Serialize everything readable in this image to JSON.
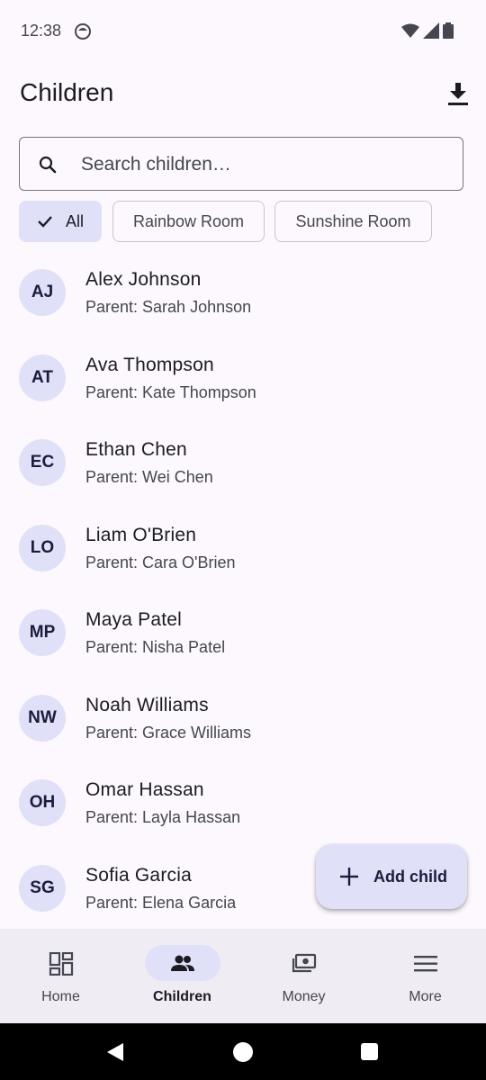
{
  "status_bar": {
    "time": "12:38"
  },
  "header": {
    "title": "Children"
  },
  "search": {
    "placeholder": "Search children…"
  },
  "filters": [
    {
      "label": "All",
      "selected": true
    },
    {
      "label": "Rainbow Room",
      "selected": false
    },
    {
      "label": "Sunshine Room",
      "selected": false
    }
  ],
  "children": [
    {
      "initials": "AJ",
      "name": "Alex Johnson",
      "parent": "Parent: Sarah Johnson"
    },
    {
      "initials": "AT",
      "name": "Ava Thompson",
      "parent": "Parent: Kate Thompson"
    },
    {
      "initials": "EC",
      "name": "Ethan Chen",
      "parent": "Parent: Wei Chen"
    },
    {
      "initials": "LO",
      "name": "Liam O'Brien",
      "parent": "Parent: Cara O'Brien"
    },
    {
      "initials": "MP",
      "name": "Maya Patel",
      "parent": "Parent: Nisha Patel"
    },
    {
      "initials": "NW",
      "name": "Noah Williams",
      "parent": "Parent: Grace Williams"
    },
    {
      "initials": "OH",
      "name": "Omar Hassan",
      "parent": "Parent: Layla Hassan"
    },
    {
      "initials": "SG",
      "name": "Sofia Garcia",
      "parent": "Parent: Elena Garcia"
    }
  ],
  "fab": {
    "label": "Add child",
    "icon": "plus-icon"
  },
  "bottom_nav": [
    {
      "label": "Home",
      "icon": "dashboard-icon",
      "active": false
    },
    {
      "label": "Children",
      "icon": "people-icon",
      "active": true
    },
    {
      "label": "Money",
      "icon": "payments-icon",
      "active": false
    },
    {
      "label": "More",
      "icon": "menu-icon",
      "active": false
    }
  ],
  "colors": {
    "background": "#fcf8fd",
    "accent_container": "#e0e0f9",
    "nav_background": "#f0ecf4"
  }
}
